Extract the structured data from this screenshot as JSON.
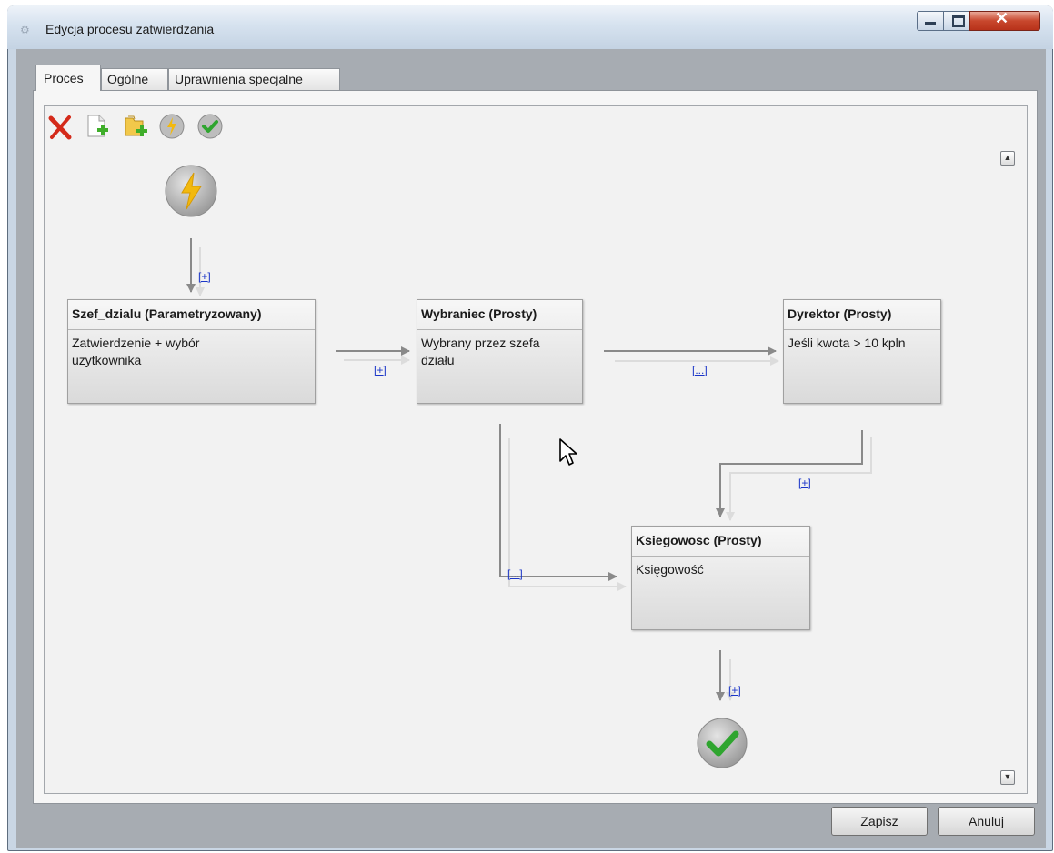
{
  "window": {
    "title": "Edycja procesu zatwierdzania"
  },
  "tabs": [
    {
      "label": "Proces",
      "selected": true
    },
    {
      "label": "Ogólne",
      "selected": false
    },
    {
      "label": "Uprawnienia specjalne",
      "selected": false
    }
  ],
  "toolbar": {
    "items": [
      "delete-icon",
      "add-document-icon",
      "add-folder-icon",
      "event-icon",
      "approve-icon"
    ]
  },
  "diagram": {
    "nodes": [
      {
        "title": "Szef_dzialu (Parametryzowany)",
        "desc1": "Zatwierdzenie + wybór",
        "desc2": "uzytkownika"
      },
      {
        "title": "Wybraniec (Prosty)",
        "desc1": "Wybrany przez szefa",
        "desc2": "działu"
      },
      {
        "title": "Dyrektor (Prosty)",
        "desc1": "Jeśli kwota > 10 kpln",
        "desc2": ""
      },
      {
        "title": "Ksiegowosc (Prosty)",
        "desc1": "Księgowość",
        "desc2": ""
      }
    ],
    "links": {
      "start_to_szef": "[+]",
      "szef_to_wybraniec": "[+]",
      "wybraniec_to_dyrektor": "[...]",
      "dyrektor_to_ksiegowosc": "[+]",
      "wybraniec_to_ksiegowosc": "[...]",
      "ksiegowosc_to_end": "[+]"
    }
  },
  "footer": {
    "save_label": "Zapisz",
    "cancel_label": "Anuluj"
  },
  "colors": {
    "link": "#1a35c8",
    "arrow": "#8a8a8a",
    "approve_green": "#2fa52f",
    "start_yellow": "#f2b90f"
  }
}
